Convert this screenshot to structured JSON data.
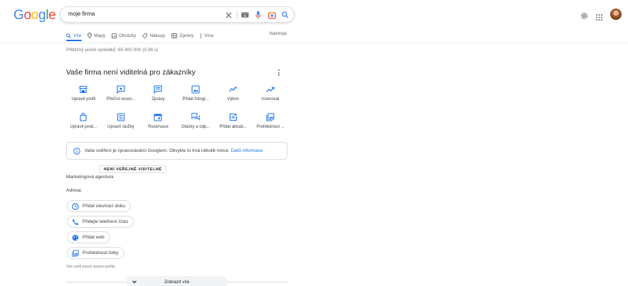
{
  "logo": {
    "text": "Google"
  },
  "search": {
    "query": "moje firma"
  },
  "tabs": [
    {
      "label": "Vše",
      "icon": "search-icon",
      "active": true
    },
    {
      "label": "Mapy",
      "icon": "map-pin-icon"
    },
    {
      "label": "Obrázky",
      "icon": "image-icon"
    },
    {
      "label": "Nákupy",
      "icon": "tag-icon"
    },
    {
      "label": "Zprávy",
      "icon": "news-icon"
    },
    {
      "label": "Více",
      "icon": "more-vert-icon"
    }
  ],
  "tools_label": "Nástroje",
  "stats": "Přibližný počet výsledků: 65 400 000 (0,36 s)",
  "business": {
    "title": "Vaše firma není viditelná pro zákazníky",
    "actions": [
      {
        "label": "Upravit profil",
        "icon": "storefront-icon"
      },
      {
        "label": "Přečíst recen...",
        "icon": "review-icon"
      },
      {
        "label": "Zprávy",
        "icon": "message-icon"
      },
      {
        "label": "Přidat fotogr...",
        "icon": "photo-icon"
      },
      {
        "label": "Výkon",
        "icon": "trend-icon"
      },
      {
        "label": "Inzerovat",
        "icon": "trending-up-icon"
      },
      {
        "label": "Upravit prod...",
        "icon": "shopping-bag-icon"
      },
      {
        "label": "Upravit služby",
        "icon": "list-icon"
      },
      {
        "label": "Rezervace",
        "icon": "calendar-icon"
      },
      {
        "label": "Otázky a odp...",
        "icon": "qa-icon"
      },
      {
        "label": "Přidat aktuál...",
        "icon": "post-add-icon"
      },
      {
        "label": "Prohlédnout ...",
        "icon": "gallery-icon"
      }
    ],
    "notice": {
      "text": "Vaše ověření je zpracováváno Googlem. Obvykle to trvá několik minut.",
      "link": "Další informace"
    },
    "badge": "NENÍ VEŘEJNĚ VIDITELNÉ",
    "category": "Marketingová agentura",
    "address_label": "Adresa:",
    "chips": [
      {
        "label": "Přidat otevírací dobu",
        "icon": "clock-icon"
      },
      {
        "label": "Přidejte telefonní číslo",
        "icon": "phone-icon"
      },
      {
        "label": "Přidat web",
        "icon": "globe-icon"
      },
      {
        "label": "Prohlédnout fotky",
        "icon": "gallery-icon"
      }
    ],
    "owner_note": "Toto uvidí pouze správci profilu",
    "show_all": "Zobrazit vše"
  },
  "colors": {
    "accent": "#1a73e8",
    "text": "#202124",
    "muted": "#5f6368"
  }
}
